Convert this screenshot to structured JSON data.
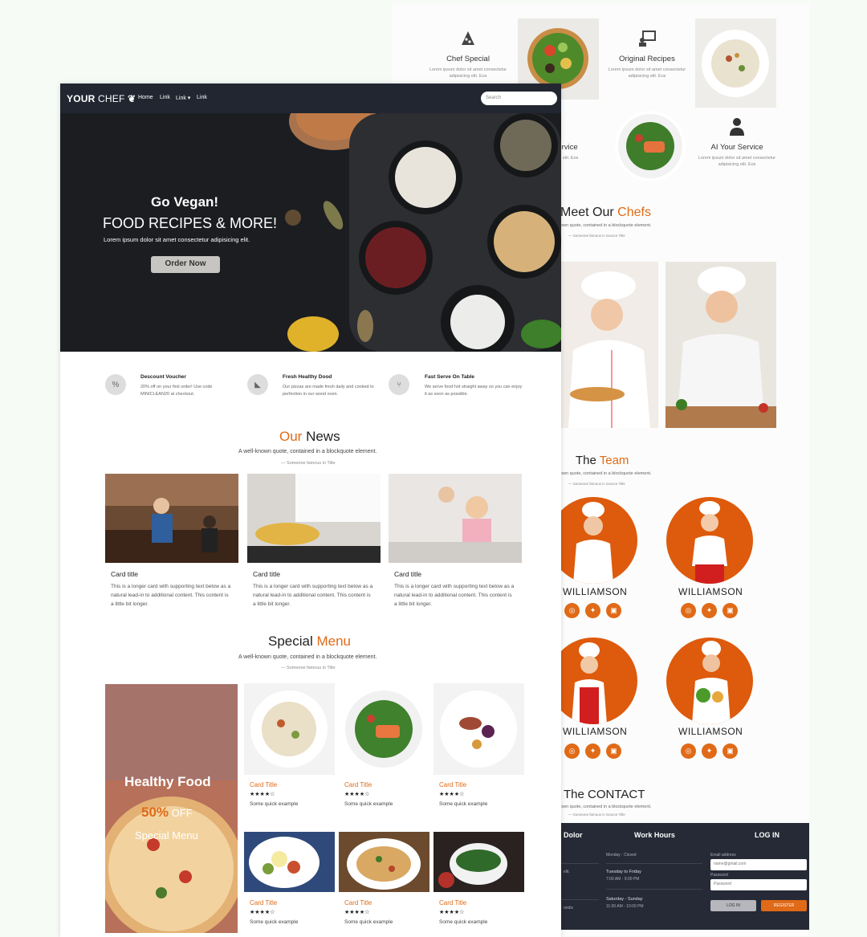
{
  "back": {
    "features": [
      {
        "title": "Chef Special",
        "desc": "Lorem ipsum dolor sit amet consectetur adipisicing elit. Eos",
        "icon": "pizza-icon"
      },
      {
        "title": "Original Recipes",
        "desc": "Lorem ipsum dolor sit amet consectetur adipisicing elit. Eos",
        "icon": "presenter-icon"
      },
      {
        "title": "Service",
        "desc": "Lorem ipsum dolor sit amet consectetur adipisicing elit. Eos",
        "icon": "user-icon"
      },
      {
        "title": "AI Your Service",
        "desc": "Lorem ipsum dolor sit amet consectetur adipisicing elit. Eos",
        "icon": "user-tie-icon"
      }
    ],
    "meet": {
      "title_a": "Meet Our ",
      "title_b": "Chefs",
      "quote": "own quote, contained in a blockquote element.",
      "source": "— Someone famous in Source Title"
    },
    "team": {
      "title_a": "The ",
      "title_b": "Team",
      "quote": "own quote, contained in a blockquote element.",
      "source": "— Someone famous in Source Title"
    },
    "chefs": [
      "WILLIAMSON",
      "WILLIAMSON",
      "WILLIAMSON",
      "WILLIAMSON"
    ],
    "contact": {
      "title": "The CONTACT",
      "quote": "own quote, contained in a blockquote element.",
      "source": "— Someone famous in Source Title"
    },
    "footer": {
      "col1_title": "Dolor",
      "col1_lines": [
        "elit.",
        "ondis"
      ],
      "hours_title": "Work Hours",
      "hours": [
        {
          "day": "Monday : Closed",
          "time": ""
        },
        {
          "day": "Tuesday to Friday",
          "time": "7:00 AM - 9:00 PM"
        },
        {
          "day": "Saturday - Sunday",
          "time": "11:00 AM - 10:00 PM"
        }
      ],
      "login_title": "LOG IN",
      "email_label": "Email address",
      "email_value": "name@gmail.com",
      "password_label": "Password",
      "password_placeholder": "Password",
      "login_button": "LOG IN",
      "register_button": "REGISTER"
    }
  },
  "nav": {
    "brand_a": "YOUR",
    "brand_b": "CHEF",
    "links": [
      "Home",
      "Link",
      "Link ▾",
      "Link"
    ],
    "search_placeholder": "Search"
  },
  "hero": {
    "line1": "Go Vegan!",
    "line2": "FOOD RECIPES & MORE!",
    "line3": "Lorem ipsum dolor sit amet consectetur adipisicing elit.",
    "button": "Order Now"
  },
  "services": [
    {
      "title": "Descount Voucher",
      "desc": "20% off on your first order! Use code MINICLEAN20 at checkout.",
      "icon": "percent-icon"
    },
    {
      "title": "Fresh Healthy Dood",
      "desc": "Our pizzas are made fresh daily and cooked to perfection in our wood oven.",
      "icon": "pizza-icon"
    },
    {
      "title": "Fast Serve On Table",
      "desc": "We serve food hot straight away so you can enjoy it as soon as possible.",
      "icon": "cutlery-icon"
    }
  ],
  "news": {
    "title_a": "Our",
    "title_b": " News",
    "quote": "A well-known quote, contained in a blockquote element.",
    "source": "— Someone famous in Title",
    "cards": [
      {
        "title": "Card title",
        "text": "This is a longer card with supporting text below as a natural lead-in to additional content. This content is a little bit longer."
      },
      {
        "title": "Card title",
        "text": "This is a longer card with supporting text below as a natural lead-in to additional content. This content is a little bit longer."
      },
      {
        "title": "Card title",
        "text": "This is a longer card with supporting text below as a natural lead-in to additional content. This content is a little bit longer."
      }
    ]
  },
  "menu": {
    "title_a": "Special",
    "title_b": " Menu",
    "quote": "A well-known quote, contained in a blockquote element.",
    "source": "— Someone famous in Title",
    "promo": {
      "line1": "Healthy Food",
      "pct": "50%",
      "off": " OFF",
      "line3": "Special Menu"
    },
    "rating": "★★★★☆",
    "items": [
      {
        "title": "Card Title",
        "text": "Some quick example"
      },
      {
        "title": "Card Title",
        "text": "Some quick example"
      },
      {
        "title": "Card Title",
        "text": "Some quick example"
      },
      {
        "title": "Card Title",
        "text": "Some quick example"
      },
      {
        "title": "Card Title",
        "text": "Some quick example"
      },
      {
        "title": "Card Title",
        "text": "Some quick example"
      }
    ]
  },
  "colors": {
    "accent": "#e06a17",
    "nav": "#212631",
    "footer": "#262a36",
    "chef_circle": "#de5a0c"
  }
}
